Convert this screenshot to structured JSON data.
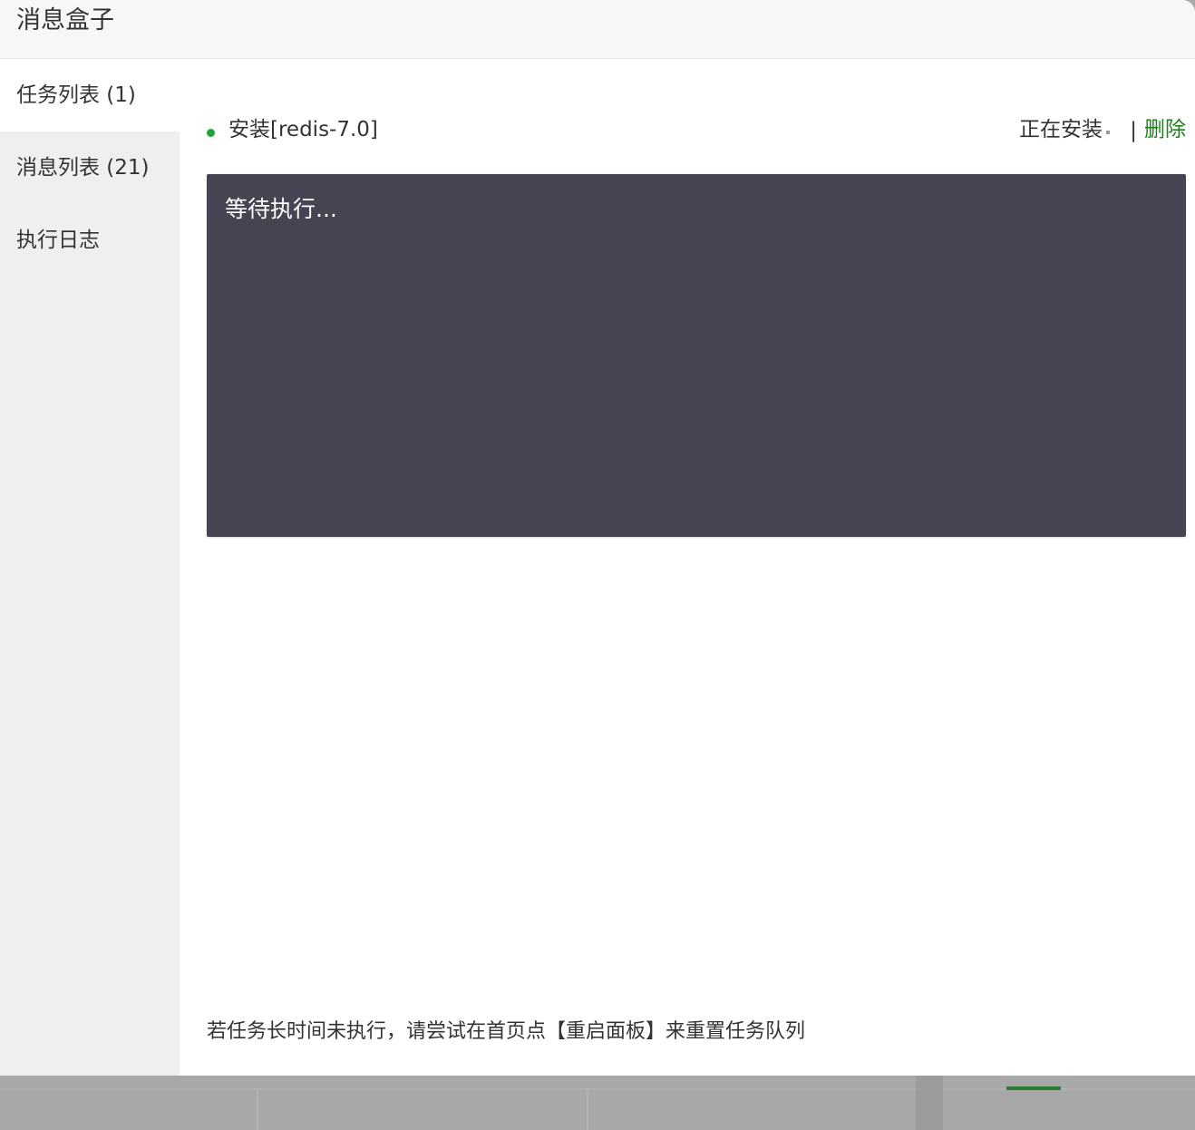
{
  "dialog": {
    "title": "消息盒子"
  },
  "sidebar": {
    "items": [
      {
        "label": "任务列表 (1)",
        "active": true
      },
      {
        "label": "消息列表 (21)",
        "active": false
      },
      {
        "label": "执行日志",
        "active": false
      }
    ]
  },
  "task": {
    "name": "安装[redis-7.0]",
    "status": "正在安装",
    "separator": "|",
    "delete_label": "删除",
    "console_text": "等待执行..."
  },
  "footer": {
    "tip": "若任务长时间未执行，请尝试在首页点【重启面板】来重置任务队列"
  },
  "colors": {
    "accent": "#20a53a",
    "link": "#1e7e1e",
    "console_bg": "#454452"
  }
}
